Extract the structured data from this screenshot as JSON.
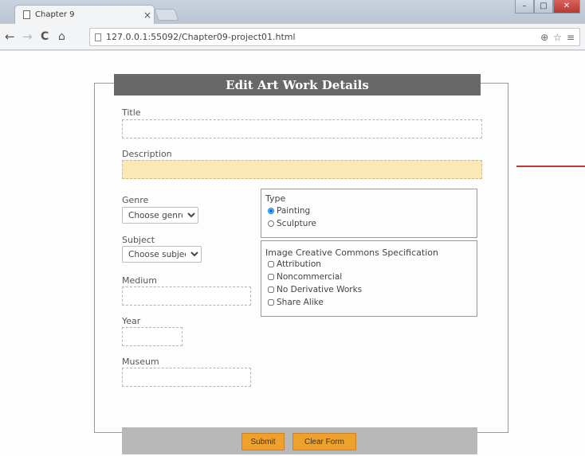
{
  "browser": {
    "tab_title": "Chapter 9",
    "tab_close": "×",
    "url": "127.0.0.1:55092/Chapter09-project01.html",
    "nav": {
      "back": "←",
      "forward": "→",
      "reload": "C",
      "home": "⌂"
    },
    "omnibox_icons": {
      "zoom": "⊕",
      "star": "☆",
      "menu": "≡"
    },
    "window": {
      "minimize": "–",
      "maximize": "□",
      "close": "✕"
    }
  },
  "form": {
    "legend": "Edit Art Work Details",
    "title_label": "Title",
    "description_label": "Description",
    "genre_label": "Genre",
    "genre_select": "Choose genre",
    "subject_label": "Subject",
    "subject_select": "Choose subject",
    "medium_label": "Medium",
    "year_label": "Year",
    "museum_label": "Museum",
    "type": {
      "title": "Type",
      "options": [
        "Painting",
        "Sculpture"
      ],
      "selected": "Painting"
    },
    "license": {
      "title": "Image Creative Commons Specification",
      "options": [
        "Attribution",
        "Noncommercial",
        "No Derivative Works",
        "Share Alike"
      ]
    },
    "submit_label": "Submit",
    "clear_label": "Clear Form"
  },
  "colors": {
    "legend_bg": "#686868",
    "description_bg": "#fbe8b4",
    "button_bg": "#f0a12b",
    "button_bar_bg": "#b8b8b8"
  }
}
